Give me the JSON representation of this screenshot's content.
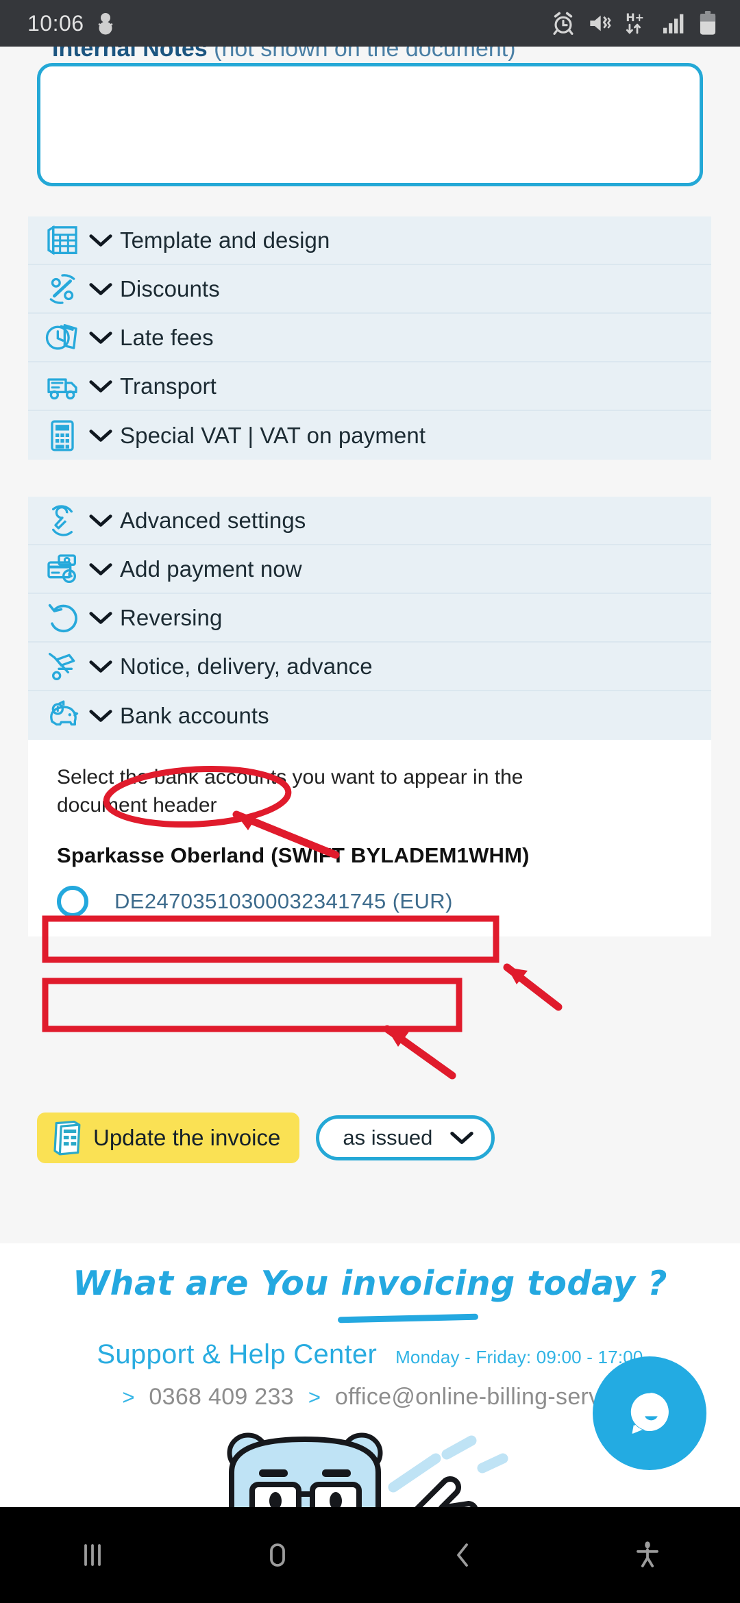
{
  "statusbar": {
    "time": "10:06",
    "icons_left": [
      "snowman-icon"
    ],
    "icons_right": [
      "alarm-icon",
      "mute-vibrate-icon",
      "hplus-data-icon",
      "signal-bars-icon",
      "battery-icon"
    ]
  },
  "notes": {
    "label_bold": "Internal Notes",
    "label_rest": " (not shown on the document)",
    "value": "",
    "placeholder": ""
  },
  "accordion_group_1": [
    {
      "icon": "template-grid-icon",
      "label": "Template and design"
    },
    {
      "icon": "percent-discount-icon",
      "label": "Discounts"
    },
    {
      "icon": "clock-money-icon",
      "label": "Late fees"
    },
    {
      "icon": "truck-icon",
      "label": "Transport"
    },
    {
      "icon": "calculator-icon",
      "label": "Special VAT | VAT on payment"
    }
  ],
  "accordion_group_2": [
    {
      "icon": "wrench-settings-icon",
      "label": "Advanced settings"
    },
    {
      "icon": "card-payment-icon",
      "label": "Add payment now"
    },
    {
      "icon": "undo-arrow-icon",
      "label": "Reversing"
    },
    {
      "icon": "hand-truck-icon",
      "label": "Notice, delivery, advance"
    },
    {
      "icon": "piggy-bank-icon",
      "label": "Bank accounts"
    }
  ],
  "bank_accounts": {
    "help_text": "Select the bank accounts you want to appear in the document header",
    "bank_name": "Sparkasse Oberland (SWIFT BYLADEM1WHM)",
    "accounts": [
      {
        "iban": "DE24703510300032341745 (EUR)",
        "selected": false
      }
    ]
  },
  "actions": {
    "update_label": "Update the invoice",
    "update_icon": "invoice-doc-icon",
    "dropdown_value": "as issued",
    "dropdown_icon": "chevron-down-icon"
  },
  "footer": {
    "headline": "What are You invoicing today ?",
    "support_title": "Support & Help Center",
    "hours": "Monday - Friday: 09:00 - 17:00",
    "chevron": ">",
    "phone": "0368 409 233",
    "email": "office@online-billing-servic",
    "chat_icon": "chat-bubble-icon",
    "mascot": "bear-mascot-icon"
  },
  "navbar": {
    "recents": "recents-icon",
    "home": "home-icon",
    "back": "back-icon",
    "accessibility": "accessibility-icon"
  },
  "colors": {
    "accent_cyan": "#24a8d6",
    "accent_yellow": "#fae154",
    "row_bg": "#e8f0f5",
    "page_bg": "#f6f6f6",
    "annotation_red": "#e01b2c",
    "text_dark": "#1c2b33"
  }
}
